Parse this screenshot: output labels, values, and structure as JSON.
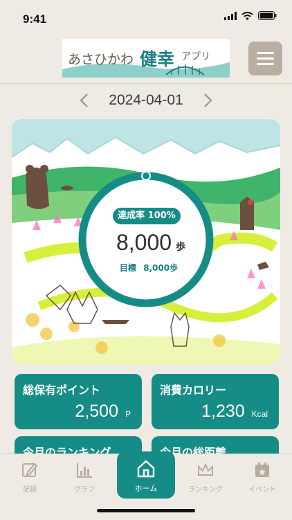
{
  "status_bar": {
    "time": "9:41"
  },
  "header": {
    "logo_text_a": "あさひかわ",
    "logo_text_b": "健幸",
    "logo_text_c": "アプリ"
  },
  "date_nav": {
    "date": "2024-04-01"
  },
  "progress": {
    "badge": "達成率 100%",
    "fraction": 1.0,
    "steps": "8,000",
    "steps_unit": "歩",
    "goal_label": "目標",
    "goal_value": "8,000歩"
  },
  "cards": [
    {
      "title": "総保有ポイント",
      "value": "2,500",
      "unit": "P"
    },
    {
      "title": "消費カロリー",
      "value": "1,230",
      "unit": "Kcal"
    },
    {
      "title": "今月のランキング"
    },
    {
      "title": "今月の総距離"
    }
  ],
  "tabs": [
    {
      "label": "記録",
      "icon": "pencil-icon"
    },
    {
      "label": "グラフ",
      "icon": "bar-chart-icon"
    },
    {
      "label": "ホーム",
      "icon": "home-icon"
    },
    {
      "label": "ランキング",
      "icon": "crown-icon"
    },
    {
      "label": "イベント",
      "icon": "calendar-icon"
    }
  ],
  "colors": {
    "primary": "#168c86",
    "background": "#efebe4",
    "menu": "#b8aea2"
  }
}
